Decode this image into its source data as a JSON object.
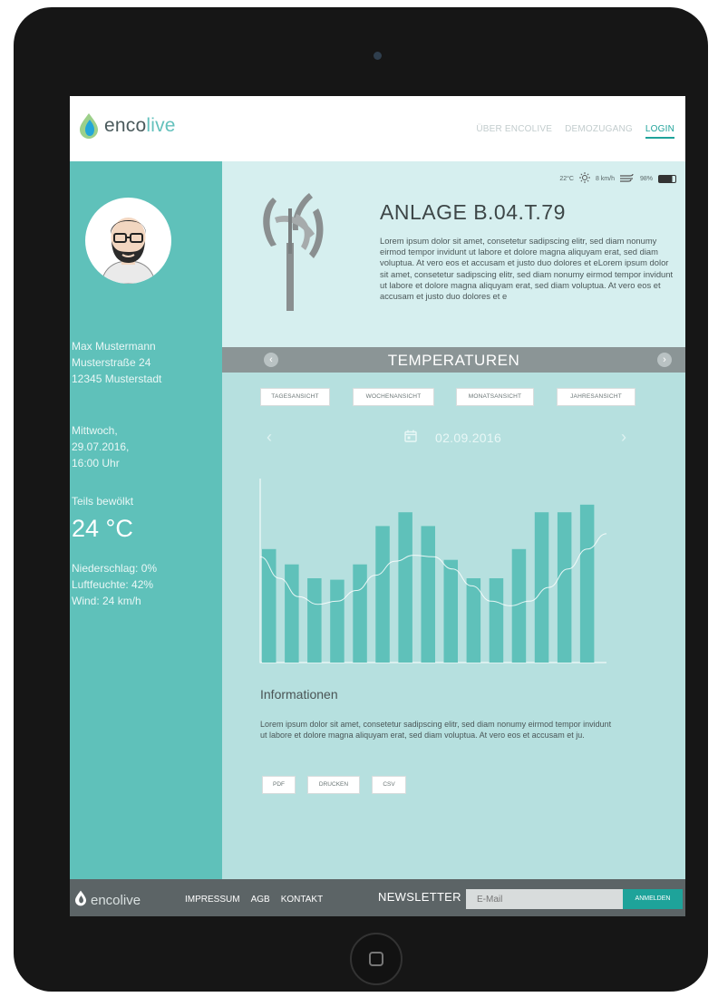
{
  "colors": {
    "brand_teal": "#5fc1ba",
    "accent_teal": "#1ea39a",
    "hero_bg": "#d6efef",
    "main_bg": "#b6e0df",
    "grey_bar": "#8b9596",
    "footer_bg": "#5c6466"
  },
  "header": {
    "logo_prefix": "enco",
    "logo_suffix": "live",
    "nav": [
      "ÜBER ENCOLIVE",
      "DEMOZUGANG",
      "LOGIN"
    ]
  },
  "sidebar": {
    "name": "Max Mustermann",
    "street": "Musterstraße 24",
    "city": "12345 Musterstadt",
    "day": "Mittwoch,",
    "date": "29.07.2016,",
    "time": "16:00 Uhr",
    "condition": "Teils bewölkt",
    "temperature": "24 °C",
    "precipitation": "Niederschlag: 0%",
    "humidity": "Luftfeuchte: 42%",
    "wind": "Wind: 24 km/h"
  },
  "status": {
    "temp": "22°C",
    "wind": "8 km/h",
    "battery": "98%",
    "icons": [
      "sun-icon",
      "wind-icon",
      "battery-icon"
    ]
  },
  "plant": {
    "title": "ANLAGE  B.04.T.79",
    "description": "Lorem ipsum dolor sit amet, consetetur sadipscing elitr, sed diam nonumy eirmod tempor invidunt ut labore et dolore magna aliquyam erat, sed diam voluptua.  At vero eos et accusam et justo duo dolores et eLorem ipsum dolor sit amet, consetetur sadipscing elitr, sed diam nonumy eirmod tempor invidunt ut labore et dolore magna aliquyam erat, sed diam voluptua.  At vero eos et accusam et justo duo dolores et e"
  },
  "section": {
    "title": "TEMPERATUREN",
    "prev_icon": "chevron-left-icon",
    "next_icon": "chevron-right-icon"
  },
  "views": [
    "TAGESANSICHT",
    "WOCHENANSICHT",
    "MONATSANSICHT",
    "JAHRESANSICHT"
  ],
  "date_nav": {
    "date": "02.09.2016",
    "prev": "‹",
    "next": "›"
  },
  "chart_data": {
    "type": "bar",
    "bar_values": [
      7.4,
      6.4,
      5.5,
      5.4,
      6.4,
      8.9,
      9.8,
      8.9,
      6.7,
      5.5,
      5.5,
      7.4,
      9.8,
      9.8,
      10.3
    ],
    "line_values": [
      6.9,
      5.5,
      4.3,
      3.8,
      4.0,
      4.7,
      5.7,
      6.6,
      7.0,
      6.9,
      6.1,
      5.0,
      4.0,
      3.7,
      4.0,
      4.9,
      6.1,
      7.4,
      8.4
    ],
    "ylim": [
      0,
      12
    ],
    "bar_color": "#5fc1ba",
    "line_color": "#ffffff",
    "axis_color": "#ffffff"
  },
  "info": {
    "heading": "Informationen",
    "text": "Lorem ipsum dolor sit amet, consetetur sadipscing elitr, sed diam nonumy eirmod tempor invidunt ut labore et dolore magna aliquyam erat, sed diam voluptua.  At vero eos et accusam et ju.",
    "buttons": [
      "PDF",
      "DRUCKEN",
      "CSV"
    ]
  },
  "footer": {
    "logo_prefix": "enco",
    "logo_suffix": "live",
    "links": [
      "IMPRESSUM",
      "AGB",
      "KONTAKT"
    ],
    "newsletter": "NEWSLETTER",
    "email_placeholder": "E-Mail",
    "submit": "ANMELDEN"
  }
}
